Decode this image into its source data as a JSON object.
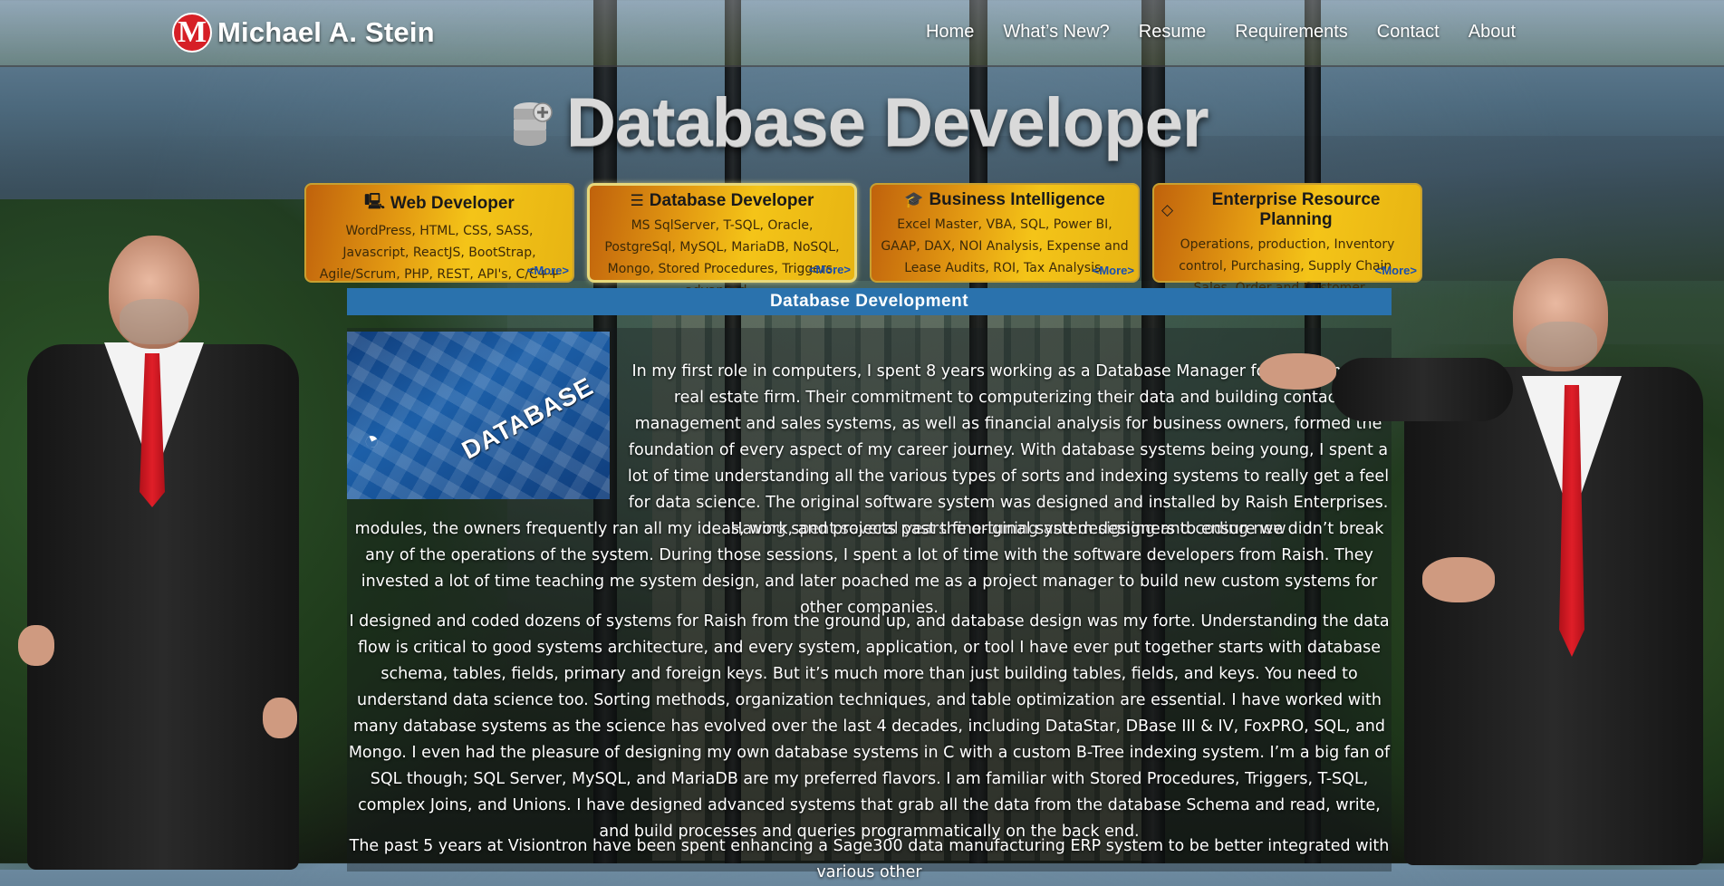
{
  "header": {
    "logo_letter": "M",
    "brand_name": "Michael A. Stein",
    "nav": [
      "Home",
      "What’s New?",
      "Resume",
      "Requirements",
      "Contact",
      "About"
    ]
  },
  "hero": {
    "title": "Database Developer",
    "icon": "database-plus-icon"
  },
  "cards": [
    {
      "icon": "monitor-icon",
      "glyph": "🖳",
      "title": "Web Developer",
      "description": "WordPress, HTML, CSS, SASS, Javascript, ReactJS, BootStrap, Agile/Scrum, PHP, REST, API's, C/C++ ...",
      "more": "<More>"
    },
    {
      "icon": "database-icon",
      "glyph": "☰",
      "title": "Database Developer",
      "description": "MS SqlServer, T-SQL, Oracle, PostgreSql, MySQL, MariaDB, NoSQL, Mongo, Stored Procedures, Triggers, advanced...",
      "more": "<More>"
    },
    {
      "icon": "graduation-cap-icon",
      "glyph": "🎓",
      "title": "Business Intelligence",
      "description": "Excel Master, VBA, SQL, Power BI, GAAP, DAX, NOI Analysis, Expense and Lease Audits, ROI, Tax Analysis.",
      "more": "<More>"
    },
    {
      "icon": "diamond-icon",
      "glyph": "◇",
      "title": "Enterprise Resource Planning",
      "description": "Operations, production, Inventory control, Purchasing, Supply Chain, Sales, Order and Customer ...",
      "more": "<More>"
    }
  ],
  "section": {
    "title": "Database Development",
    "image_label": "DATABASE",
    "paragraph1a": "In my first role in computers, I spent 8 years working as a Database Manager for a commercial real estate firm. Their commitment to computerizing their data and building contact management and sales systems, as well as financial analysis for business owners, formed the foundation of every aspect of my career journey. With database systems being young, I spent a lot of time understanding all the various types of sorts and indexing systems to really get a feel for data science. The original software system was designed and installed by Raish Enterprises. Having spent several years fine-tuning and designing and coding new",
    "paragraph1b": "modules, the owners frequently ran all my ideas, work, and projects past the original system designers to ensure we didn’t break any of the operations of the system. During those sessions, I spent a lot of time with the software developers from Raish. They invested a lot of time teaching me system design, and later poached me as a project manager to build new custom systems for other companies.",
    "paragraph2": "I designed and coded dozens of systems for Raish from the ground up, and database design was my forte. Understanding the data flow is critical to good systems architecture, and every system, application, or tool I have ever put together starts with database schema, tables, fields, primary and foreign keys. But it’s much more than just building tables, fields, and keys. You need to understand data science too. Sorting methods, organization techniques, and table optimization are essential. I have worked with many database systems as the science has evolved over the last 4 decades, including DataStar, DBase III & IV, FoxPRO, SQL, and Mongo. I even had the pleasure of designing my own database systems in C with a custom B-Tree indexing system. I’m a big fan of SQL though; SQL Server, MySQL, and MariaDB are my preferred flavors. I am familiar with Stored Procedures, Triggers, T-SQL, complex Joins, and Unions. I have designed advanced systems that grab all the data from the database Schema and read, write, and build processes and queries programmatically on the back end.",
    "paragraph3": "The past 5 years at Visiontron have been spent enhancing a Sage300 data manufacturing ERP system to be better integrated with various other"
  }
}
